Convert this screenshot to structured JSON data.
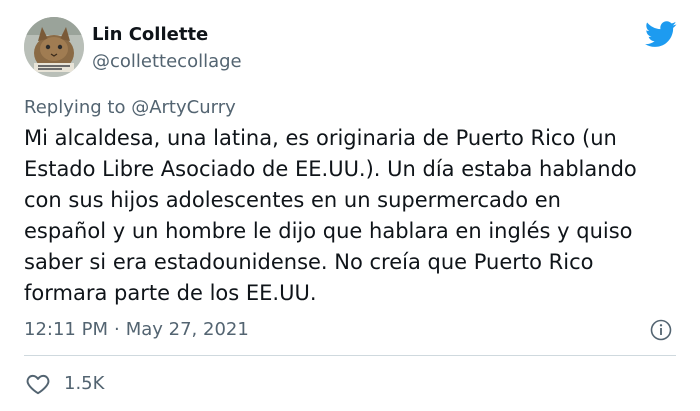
{
  "author": {
    "display_name": "Lin Collette",
    "handle": "@collettecollage",
    "avatar_icon": "cat-photo-avatar"
  },
  "brand": {
    "icon": "twitter-bird-icon",
    "color": "#1d9bf0"
  },
  "reply": {
    "prefix": "Replying to",
    "mention": "@ArtyCurry"
  },
  "tweet": {
    "lines": [
      "Mi alcaldesa, una latina, es originaria de Puerto Rico (un",
      "Estado Libre Asociado de EE.UU.). Un día estaba hablando",
      "con sus hijos adolescentes en un supermercado en",
      "español y un hombre le dijo que hablara en inglés y quiso",
      "saber si era estadounidense. No creía que Puerto Rico",
      "formara parte de los EE.UU."
    ]
  },
  "meta": {
    "time": "12:11 PM",
    "separator": "·",
    "date": "May 27, 2021"
  },
  "actions": {
    "like_count": "1.5K"
  }
}
